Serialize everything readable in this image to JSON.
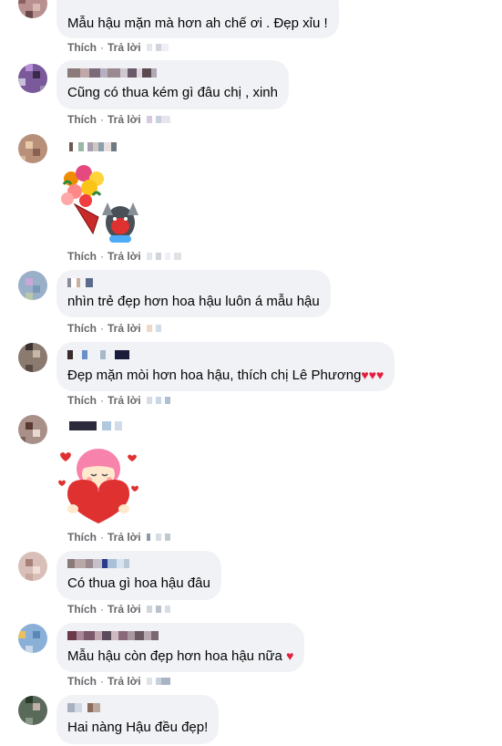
{
  "actions": {
    "like": "Thích",
    "reply": "Trả lời",
    "separator": "·"
  },
  "comments": [
    {
      "text": "Mẫu hậu mặn mà hơn ah chế ơi . Đẹp xỉu !"
    },
    {
      "text": "Cũng có thua kém gì đâu chị , xinh"
    },
    {
      "text": "",
      "sticker": "flower-bouquet-puppy-sticker"
    },
    {
      "text": "nhìn trẻ đẹp hơn hoa hậu luôn á mẫu hậu"
    },
    {
      "text": "Đẹp mặn mòi hơn hoa hậu, thích chị Lê Phương",
      "hearts": "♥♥♥"
    },
    {
      "text": "",
      "sticker": "girl-holding-heart-sticker"
    },
    {
      "text": "Có thua gì hoa hậu đâu"
    },
    {
      "text": "Mẫu hậu còn đẹp hơn hoa hậu nữa",
      "hearts": "♥"
    },
    {
      "text": "Hai nàng Hậu đều đẹp!"
    }
  ],
  "colors": {
    "bubble": "#f0f2f5",
    "action_text": "#65676b",
    "heart": "#e41e3f"
  }
}
